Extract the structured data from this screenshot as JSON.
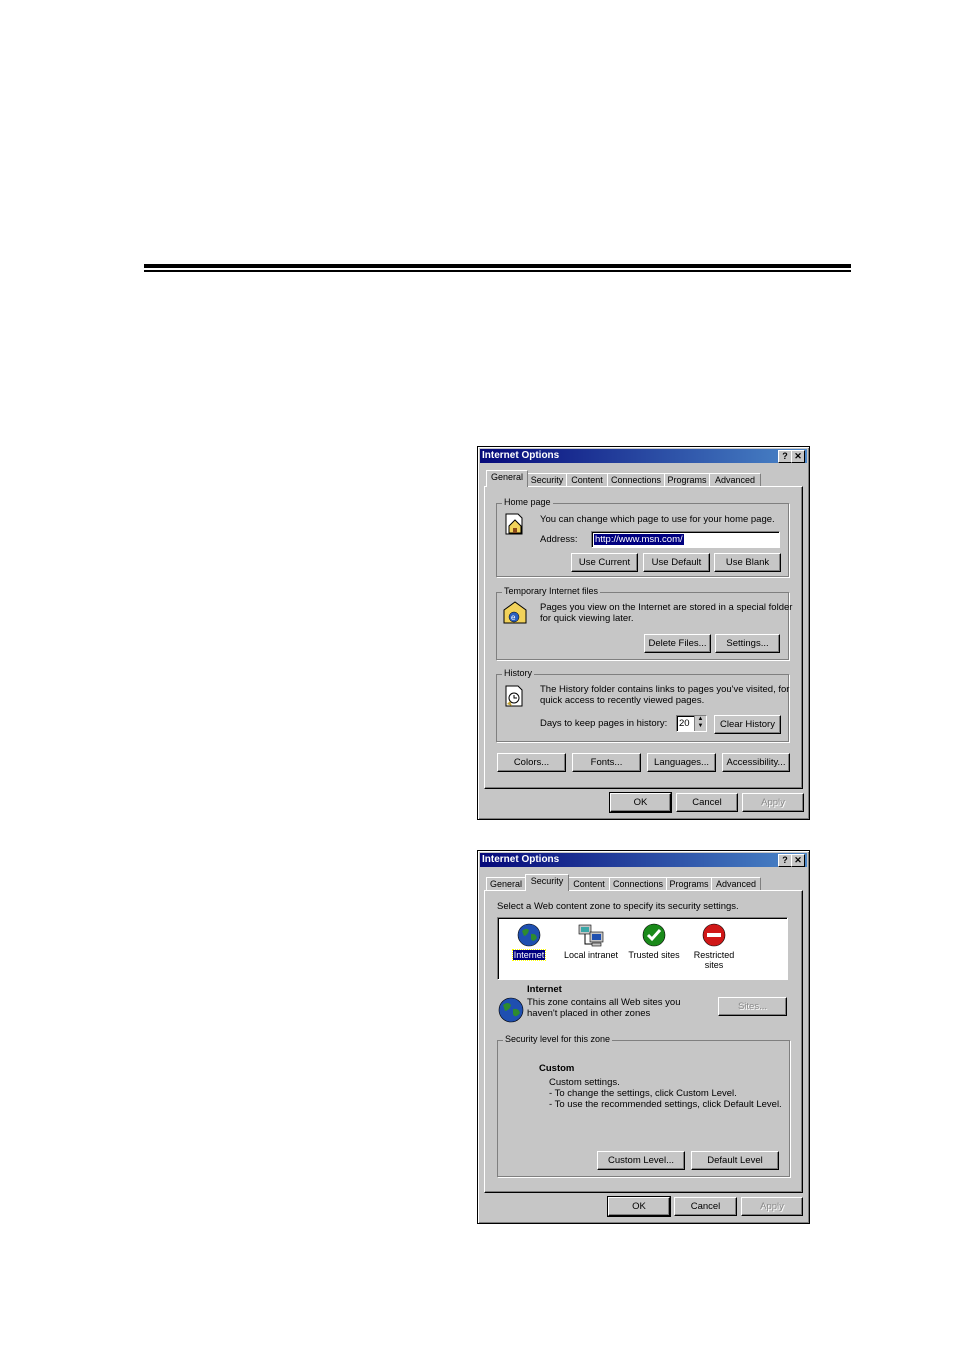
{
  "dialog1": {
    "title": "Internet Options",
    "tabs": [
      "General",
      "Security",
      "Content",
      "Connections",
      "Programs",
      "Advanced"
    ],
    "home_page": {
      "group_label": "Home page",
      "description": "You can change which page to use for your home page.",
      "address_label": "Address:",
      "address_value": "http://www.msn.com/",
      "use_current": "Use Current",
      "use_default": "Use Default",
      "use_blank": "Use Blank"
    },
    "temp_files": {
      "group_label": "Temporary Internet files",
      "description_line1": "Pages you view on the Internet are stored in a special folder",
      "description_line2": "for quick viewing later.",
      "delete_files": "Delete Files...",
      "settings": "Settings..."
    },
    "history": {
      "group_label": "History",
      "description_line1": "The History folder contains links to pages you've visited, for",
      "description_line2": "quick access to recently viewed pages.",
      "days_label": "Days to keep pages in history:",
      "days_value": "20",
      "clear_history": "Clear History"
    },
    "bottom_buttons": {
      "colors": "Colors...",
      "fonts": "Fonts...",
      "languages": "Languages...",
      "accessibility": "Accessibility..."
    },
    "ok": "OK",
    "cancel": "Cancel",
    "apply": "Apply"
  },
  "dialog2": {
    "title": "Internet Options",
    "tabs": [
      "General",
      "Security",
      "Content",
      "Connections",
      "Programs",
      "Advanced"
    ],
    "instruction": "Select a Web content zone to specify its security settings.",
    "zones": [
      {
        "label_line1": "Internet",
        "label_line2": "",
        "icon": "globe-icon"
      },
      {
        "label_line1": "Local intranet",
        "label_line2": "",
        "icon": "network-computers-icon"
      },
      {
        "label_line1": "Trusted sites",
        "label_line2": "",
        "icon": "green-check-icon"
      },
      {
        "label_line1": "Restricted",
        "label_line2": "sites",
        "icon": "red-no-entry-icon"
      }
    ],
    "zone_name": "Internet",
    "zone_desc_line1": "This zone contains all Web sites you",
    "zone_desc_line2": "haven't placed in other zones",
    "sites": "Sites...",
    "security_group_label": "Security level for this zone",
    "level_name": "Custom",
    "level_line1": "Custom settings.",
    "level_line2": "- To change the settings, click Custom Level.",
    "level_line3": "- To use the recommended settings, click Default Level.",
    "custom_level": "Custom Level...",
    "default_level": "Default Level",
    "ok": "OK",
    "cancel": "Cancel",
    "apply": "Apply"
  }
}
